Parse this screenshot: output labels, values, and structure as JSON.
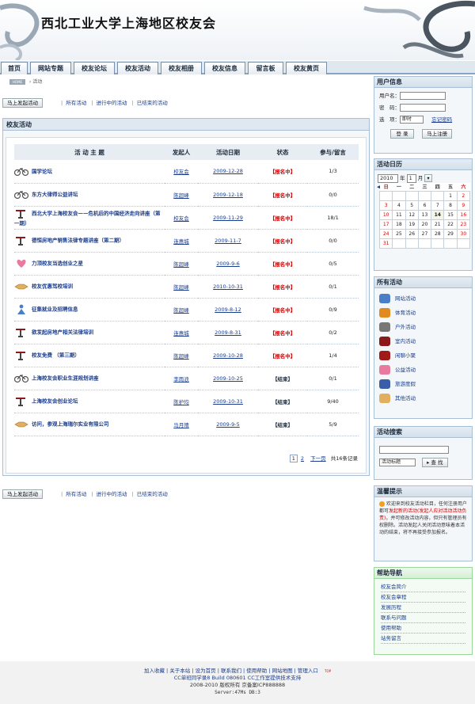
{
  "header": {
    "site_title": "西北工业大学上海地区校友会"
  },
  "nav": {
    "tabs": [
      "首页",
      "网站专题",
      "校友论坛",
      "校友活动",
      "校友相册",
      "校友信息",
      "留言板",
      "校友黄页"
    ]
  },
  "breadcrumb": {
    "home_label": "HOME",
    "current": "活动"
  },
  "actbar": {
    "new_button": "马上发起活动",
    "all": "所有活动",
    "ongoing": "进行中的活动",
    "ended": "已结束的活动"
  },
  "panel": {
    "title": "校友活动"
  },
  "table": {
    "headers": [
      "活 动 主 题",
      "发起人",
      "活动日期",
      "状态",
      "参与/留言"
    ],
    "rows": [
      {
        "icon": "bicycle-icon",
        "topic": "国学论坛",
        "user": "校友会",
        "date": "2009-12-28",
        "status": "【报名中】",
        "count": "1/3",
        "active": true
      },
      {
        "icon": "bicycle-icon",
        "topic": "东方大律师公益讲坛",
        "user": "陈超峰",
        "date": "2009-12-18",
        "status": "【报名中】",
        "count": "0/0",
        "active": true
      },
      {
        "icon": "lectern-icon",
        "topic": "西北大学上海校友会——危机后的中国经济走向讲座（第一期）",
        "user": "校友会",
        "date": "2009-11-29",
        "status": "【报名中】",
        "count": "18/1",
        "active": true
      },
      {
        "icon": "lectern-icon",
        "topic": "德恒房地产销售法律专题讲座（第二期）",
        "user": "连惠城",
        "date": "2009-11-7",
        "status": "【报名中】",
        "count": "0/0",
        "active": true
      },
      {
        "icon": "heart-icon",
        "topic": "力顶校友当选创业之星",
        "user": "陈超峰",
        "date": "2009-9-6",
        "status": "【报名中】",
        "count": "0/5",
        "active": true
      },
      {
        "icon": "handshake-icon",
        "topic": "校友优惠驾校培训",
        "user": "陈超峰",
        "date": "2010-10-31",
        "status": "【报名中】",
        "count": "0/1",
        "active": true
      },
      {
        "icon": "person-icon",
        "topic": "征集就业及招聘信息",
        "user": "陈超峰",
        "date": "2009-8-12",
        "status": "【报名中】",
        "count": "0/9",
        "active": true
      },
      {
        "icon": "lectern-icon",
        "topic": "欲发起房地产相关法律培训",
        "user": "连惠城",
        "date": "2009-8-31",
        "status": "【报名中】",
        "count": "0/2",
        "active": true
      },
      {
        "icon": "lectern-icon",
        "topic": "校友免费 （第三期）",
        "user": "陈超峰",
        "date": "2009-10-28",
        "status": "【报名中】",
        "count": "1/4",
        "active": true
      },
      {
        "icon": "bicycle-icon",
        "topic": "上海校友会职业生涯规划讲座",
        "user": "李雨浪",
        "date": "2009-10-25",
        "status": "【结束】",
        "count": "0/1",
        "active": false
      },
      {
        "icon": "lectern-icon",
        "topic": "上海校友会创业论坛",
        "user": "陈护均",
        "date": "2009-10-31",
        "status": "【结束】",
        "count": "9/40",
        "active": false
      },
      {
        "icon": "handshake-icon",
        "topic": "访问，参观上海瑞尔实业有限公司",
        "user": "马月晴",
        "date": "2009-9-5",
        "status": "【结束】",
        "count": "5/9",
        "active": false
      }
    ]
  },
  "pager": {
    "p1": "1",
    "p2": "2",
    "next": "下一页",
    "total": "共16条记录"
  },
  "sidebar": {
    "user": {
      "title": "用户信息",
      "user_label": "用户名：",
      "pass_label": "密　码：",
      "opt_label": "选　项：",
      "opt_value": "即时",
      "forgot": "忘记密码",
      "login": "登 录",
      "register": "马上注册"
    },
    "cal": {
      "title": "活动日历",
      "year": "2010",
      "year_label": "年",
      "month": "1",
      "month_label": "月",
      "weekdays": [
        "日",
        "一",
        "二",
        "三",
        "四",
        "五",
        "六"
      ],
      "rows": [
        [
          "",
          "",
          "",
          "",
          "",
          "1",
          "2"
        ],
        [
          "3",
          "4",
          "5",
          "6",
          "7",
          "8",
          "9"
        ],
        [
          "10",
          "11",
          "12",
          "13",
          "14",
          "15",
          "16"
        ],
        [
          "17",
          "18",
          "19",
          "20",
          "21",
          "22",
          "23"
        ],
        [
          "24",
          "25",
          "26",
          "27",
          "28",
          "29",
          "30"
        ],
        [
          "31",
          "",
          "",
          "",
          "",
          "",
          ""
        ]
      ]
    },
    "acts": {
      "title": "所有活动",
      "items": [
        "网站活动",
        "体育活动",
        "户外活动",
        "室内活动",
        "闲聊小聚",
        "公益活动",
        "旅游度假",
        "其他活动"
      ]
    },
    "search": {
      "title": "活动搜索",
      "select": "活动标题",
      "button": "查 找"
    },
    "tip": {
      "title": "温馨提示",
      "text_a": "欢迎来到校友活动栏目，任何注册用户都可",
      "text_red": "发起新的活动(发起人应对活动活动负责)",
      "text_b": "，并可修改活动内容，但只有管理员有权删除。活动发起人关闭活动意味着本活动的结束，将不再接受参加报名。"
    },
    "help": {
      "title": "帮助导航",
      "items": [
        "校友会简介",
        "校友会章程",
        "发展历程",
        "联系与问题",
        "使用帮助",
        "站务留言"
      ]
    }
  },
  "footer": {
    "links": "加入收藏 | 关于本站 | 设为首页 | 联系我们 | 使用帮助 | 网站地图 | 管理入口",
    "top": "TOP",
    "line2": "CC单班同学录8 Build 080601 CC工作室提供技术支持",
    "line3": "2008-2010 版权所有 京备案ICP888888",
    "line4": "Server:47Ms  DB:3"
  }
}
